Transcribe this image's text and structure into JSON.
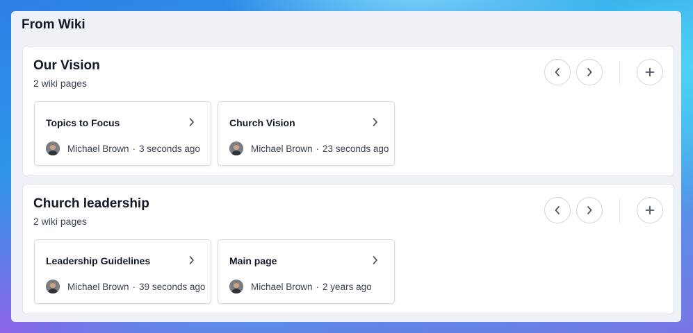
{
  "panel": {
    "title": "From Wiki"
  },
  "groups": [
    {
      "title": "Our Vision",
      "count": "2 wiki pages",
      "cards": [
        {
          "title": "Topics to Focus",
          "author": "Michael Brown",
          "separator": "·",
          "time": "3 seconds ago"
        },
        {
          "title": "Church Vision",
          "author": "Michael Brown",
          "separator": "·",
          "time": "23 seconds ago"
        }
      ]
    },
    {
      "title": "Church leadership",
      "count": "2 wiki pages",
      "cards": [
        {
          "title": "Leadership Guidelines",
          "author": "Michael Brown",
          "separator": "·",
          "time": "39 seconds ago"
        },
        {
          "title": "Main page",
          "author": "Michael Brown",
          "separator": "·",
          "time": "2 years ago"
        }
      ]
    }
  ],
  "icons": {
    "prev": "chevron-left-icon",
    "next": "chevron-right-icon",
    "add": "plus-icon",
    "card_open": "chevron-right-icon",
    "avatar": "user-avatar"
  },
  "colors": {
    "text": "#111827",
    "muted": "#374151",
    "icon": "#4b5563"
  }
}
